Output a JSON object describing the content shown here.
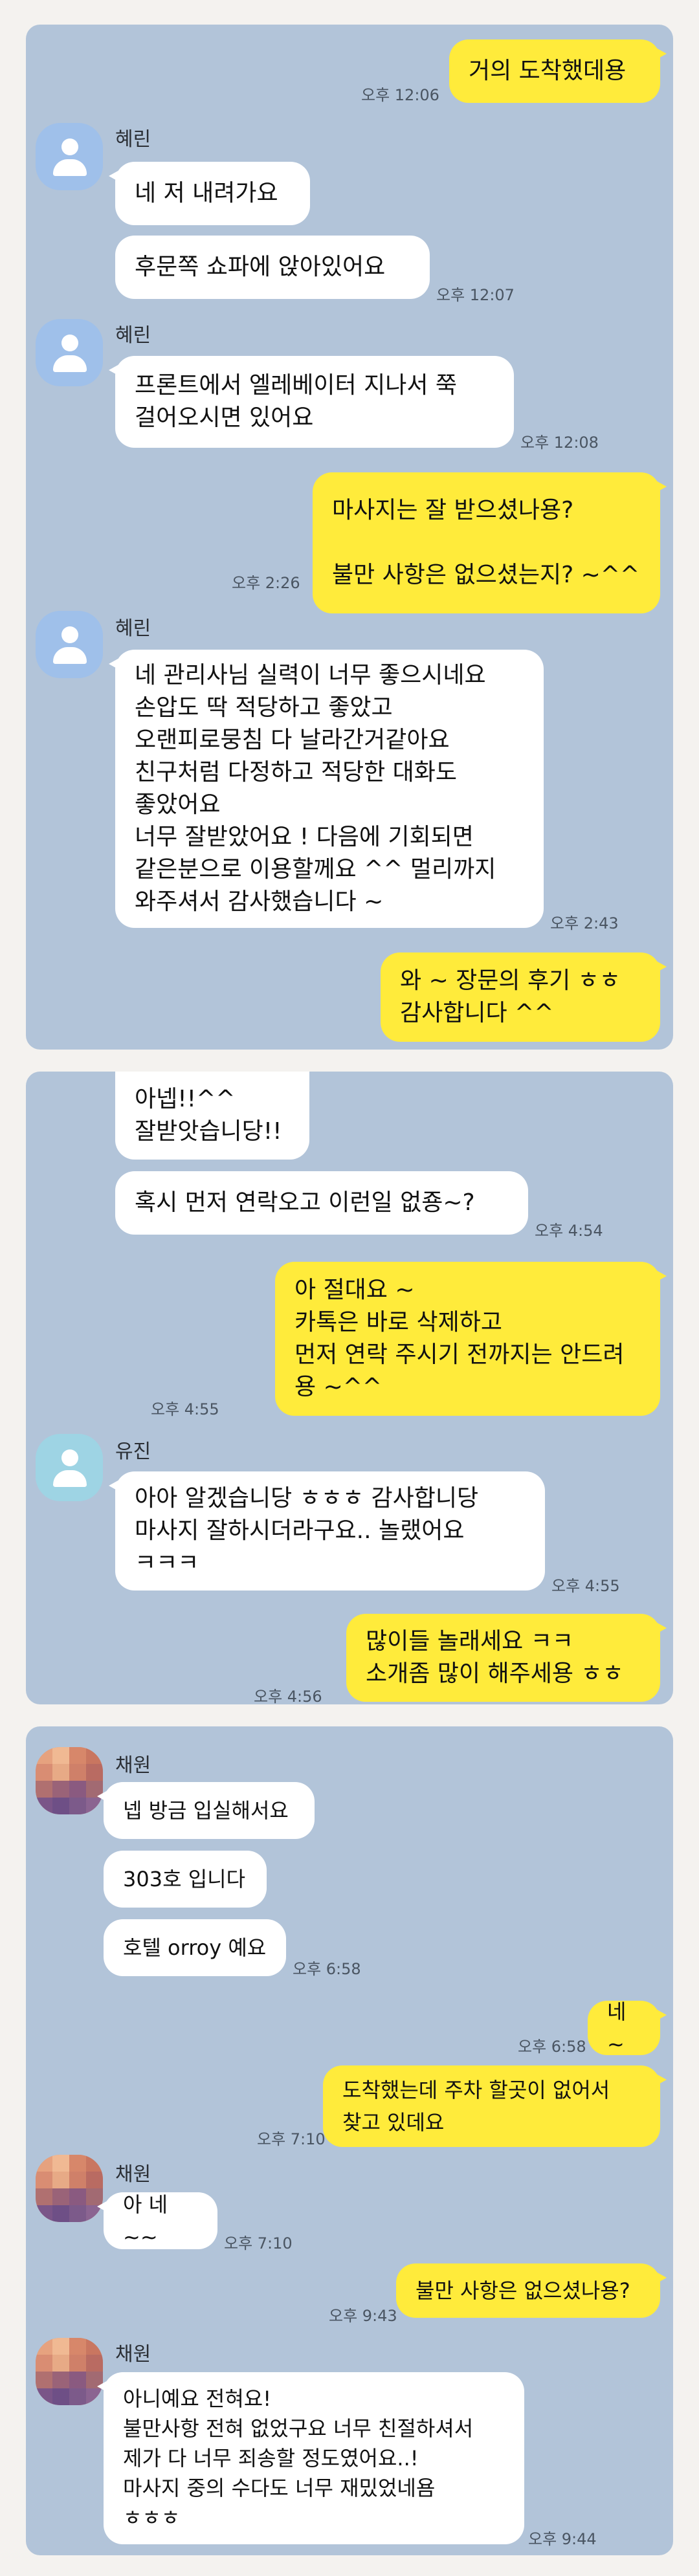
{
  "panel1": {
    "msg1": {
      "text": "거의 도착했데용",
      "time": "오후 12:06"
    },
    "sender_hyerin": "혜린",
    "msg2": {
      "text": "네 저 내려가요"
    },
    "msg3": {
      "text": "후문쪽 쇼파에 앉아있어요",
      "time": "오후 12:07"
    },
    "msg4": {
      "text": "프론트에서 엘레베이터 지나서 쭉\n걸어오시면 있어요",
      "time": "오후 12:08"
    },
    "msg5": {
      "text": "마사지는 잘 받으셨나용?\n\n불만 사항은 없으셨는지? ~^^",
      "time": "오후 2:26"
    },
    "msg6": {
      "text": "네 관리사님 실력이 너무 좋으시네요\n손압도 딱 적당하고 좋았고\n오랜피로뭉침 다 날라간거같아요\n친구처럼 다정하고 적당한 대화도\n좋았어요\n너무 잘받았어요 ! 다음에 기회되면\n같은분으로 이용할께요 ^^ 멀리까지\n와주셔서 감사했습니다 ~",
      "time": "오후 2:43"
    },
    "msg7": {
      "text": "와 ~ 장문의 후기 ㅎㅎ\n감사합니다 ^^"
    }
  },
  "panel2": {
    "msg1": {
      "text": "아넵!!^^\n잘받앗습니당!!"
    },
    "msg2": {
      "text": "혹시 먼저 연락오고 이런일 없죵~?",
      "time": "오후 4:54"
    },
    "msg3": {
      "text": "아 절대요 ~\n카톡은 바로 삭제하고\n먼저 연락 주시기 전까지는 안드려\n용 ~^^",
      "time": "오후 4:55"
    },
    "sender_yujin": "유진",
    "msg4": {
      "text": "아아 알겠습니당 ㅎㅎㅎ 감사합니당\n마사지 잘하시더라구요.. 놀랬어요\nㅋㅋㅋ",
      "time": "오후 4:55"
    },
    "msg5": {
      "text": "많이들 놀래세요 ㅋㅋ\n소개좀 많이 해주세용 ㅎㅎ",
      "time": "오후 4:56"
    }
  },
  "panel3": {
    "sender_chaewon": "채원",
    "msg1": {
      "text": "넵 방금 입실해서요"
    },
    "msg2": {
      "text": "303호 입니다"
    },
    "msg3": {
      "text": "호텔 orroy 예요",
      "time": "오후 6:58"
    },
    "msg4": {
      "text": "네 ~",
      "time": "오후 6:58"
    },
    "msg5": {
      "text": "도착했는데  주차 할곳이 없어서\n찾고 있데요",
      "time": "오후 7:10"
    },
    "msg6": {
      "text": "아 네~~",
      "time": "오후 7:10"
    },
    "msg7": {
      "text": "불만 사항은 없으셨나용?",
      "time": "오후 9:43"
    },
    "msg8": {
      "text": "아니예요 전혀요!\n불만사항 전혀 없었구요 너무 친절하셔서\n제가 다 너무 죄송할 정도였어요..!\n마사지 중의 수다도 너무 재밌었네욤\nㅎㅎㅎ",
      "time": "오후 9:44"
    }
  },
  "colors": {
    "background": "#b2c4d9",
    "my_bubble": "#ffeb3b",
    "other_bubble": "#ffffff"
  },
  "icons": {
    "default_avatar": "person-icon",
    "blurred_avatar": "mosaic-avatar"
  }
}
